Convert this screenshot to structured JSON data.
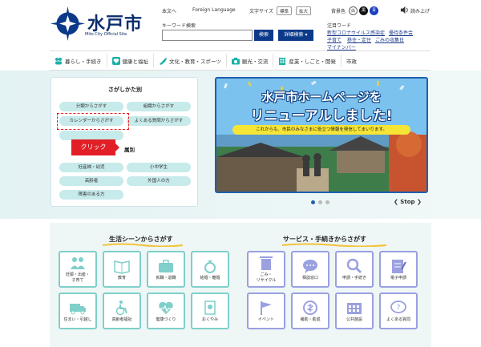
{
  "header": {
    "logo_title": "水戸市",
    "logo_sub": "Mito City Official Site",
    "links": [
      "本文へ",
      "Foreign Language"
    ],
    "font_size_label": "文字サイズ",
    "font_size_options": [
      "標準",
      "拡大"
    ],
    "color_label": "背景色",
    "color_options": [
      "白",
      "黒",
      "青"
    ],
    "read_aloud": "読み上げ",
    "keyword_label": "キーワード検索",
    "search_button": "検索",
    "detail_button": "詳細検索 ▾",
    "chui_label": "注目ワード",
    "chui_words": [
      "新型コロナウイルス感染症",
      "優待条件会",
      "子育て",
      "移住・定住",
      "ごみの収集日",
      "マイナンバー"
    ]
  },
  "nav": [
    {
      "icon": "people-icon",
      "label": "暮らし・手続き"
    },
    {
      "icon": "heart-icon",
      "label": "健康と福祉"
    },
    {
      "icon": "brush-icon",
      "label": "文化・教育・スポーツ"
    },
    {
      "icon": "camera-icon",
      "label": "観光・交流"
    },
    {
      "icon": "building-icon",
      "label": "産業・しごと・開発"
    },
    {
      "icon": "",
      "label": "市政"
    }
  ],
  "finder": {
    "title": "さがしかた別",
    "pills_top": [
      "分類からさがす",
      "組織からさがす",
      "カレンダーからさがす",
      "よくある質問からさがす"
    ],
    "section2": "属別",
    "pills_bottom": [
      "妊産婦・幼児",
      "小中学生",
      "高齢者",
      "外国人の方",
      "障害のある方"
    ],
    "click_label": "クリック"
  },
  "banner": {
    "line1": "水戸市ホームページを",
    "line2": "リニューアルしました!",
    "sub": "これからも、市民のみなさまに役立つ情報を発信してまいります。",
    "control": "❮ Stop ❯"
  },
  "life": {
    "title": "生活シーンからさがす",
    "color": "#7fcfca",
    "tiles": [
      {
        "icon": "family-icon",
        "label": "妊娠・出産・\n子育て"
      },
      {
        "icon": "book-icon",
        "label": "教育"
      },
      {
        "icon": "briefcase-icon",
        "label": "就職・退職"
      },
      {
        "icon": "ring-icon",
        "label": "結婚・離婚"
      },
      {
        "icon": "truck-icon",
        "label": "住まい・引越し"
      },
      {
        "icon": "wheelchair-icon",
        "label": "高齢者福祉"
      },
      {
        "icon": "pulse-icon",
        "label": "健康づくり"
      },
      {
        "icon": "flower-icon",
        "label": "おくやみ"
      }
    ]
  },
  "service": {
    "title": "サービス・手続きからさがす",
    "color": "#9aa0e0",
    "tiles": [
      {
        "icon": "trash-icon",
        "label": "ごみ・\nリサイクル"
      },
      {
        "icon": "chat-icon",
        "label": "相談窓口"
      },
      {
        "icon": "magnifier-icon",
        "label": "申請・手続き"
      },
      {
        "icon": "form-icon",
        "label": "電子申請"
      },
      {
        "icon": "flag-icon",
        "label": "イベント"
      },
      {
        "icon": "gift-icon",
        "label": "補助・助成"
      },
      {
        "icon": "facility-icon",
        "label": "公共施設"
      },
      {
        "icon": "question-icon",
        "label": "よくある質問"
      }
    ]
  }
}
